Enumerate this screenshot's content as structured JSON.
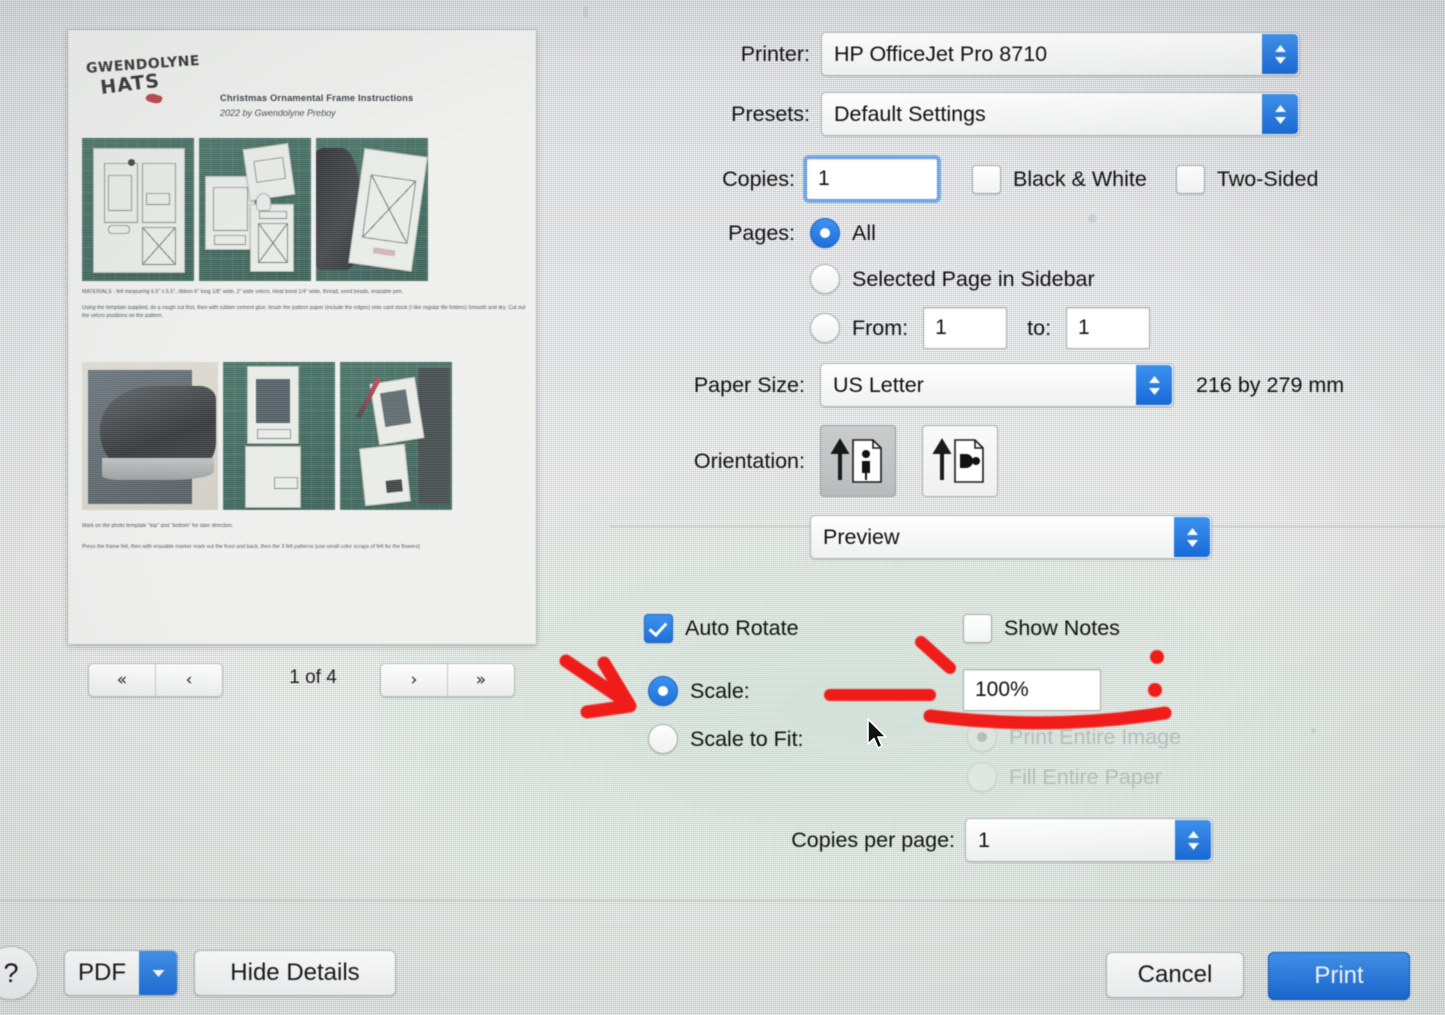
{
  "dialog": {
    "printer": {
      "label": "Printer:",
      "value": "HP OfficeJet Pro 8710"
    },
    "presets": {
      "label": "Presets:",
      "value": "Default Settings"
    },
    "copies": {
      "label": "Copies:",
      "value": "1"
    },
    "black_white": {
      "label": "Black & White",
      "checked": false
    },
    "two_sided": {
      "label": "Two-Sided",
      "checked": false
    },
    "pages": {
      "label": "Pages:",
      "all": "All",
      "selected_page": "Selected Page in Sidebar",
      "from_label": "From:",
      "from_value": "1",
      "to_label": "to:",
      "to_value": "1",
      "selection": "All"
    },
    "paper_size": {
      "label": "Paper Size:",
      "value": "US Letter",
      "dimensions": "216 by 279 mm"
    },
    "orientation": {
      "label": "Orientation:",
      "portrait_icon": "portrait-page-icon",
      "landscape_icon": "landscape-page-icon",
      "selected": "portrait"
    },
    "pane": {
      "value": "Preview"
    },
    "auto_rotate": {
      "label": "Auto Rotate",
      "checked": true
    },
    "show_notes": {
      "label": "Show Notes",
      "checked": false
    },
    "scale": {
      "label": "Scale:",
      "selected": true,
      "value": "100%"
    },
    "scale_to_fit": {
      "label": "Scale to Fit:",
      "selected": false
    },
    "print_entire_image": {
      "label": "Print Entire Image",
      "selected": true,
      "disabled": true
    },
    "fill_entire_paper": {
      "label": "Fill Entire Paper",
      "selected": false,
      "disabled": true
    },
    "copies_per_page": {
      "label": "Copies per page:",
      "value": "1"
    }
  },
  "preview": {
    "nav": {
      "first_label": "«",
      "prev_label": "‹",
      "next_label": "›",
      "last_label": "»",
      "page_indicator": "1 of 4"
    },
    "document": {
      "logo_line1": "GWENDOLYNE",
      "logo_line2": "HATS",
      "title": "Christmas Ornamental Frame Instructions",
      "subtitle": "2022 by Gwendolyne Preboy",
      "paragraph1": "MATERIALS -  felt measuring 6.5\" x 5.5\", ribbon 6\" long 1/8\" wide, 2\" wide velcro, Heat bond 1/4\" wide, thread, seed beads, erasable pen.",
      "paragraph2": "Using the template supplied, do a rough cut first, then with rubber cement glue, brush the pattern paper (include the edges) onto card stock (I like regular file folders) Smooth and dry. Cut out the velcro positions on the pattern.",
      "paragraph3": "Mark on the photo template \"top\" and \"bottom\" for later direction.",
      "paragraph4": "Press the frame felt, then with erasable marker mark out the front and back, then the 3 felt patterns (use small color scraps of felt for the flowers)"
    }
  },
  "bottom_bar": {
    "help_label": "?",
    "pdf_label": "PDF",
    "hide_details_label": "Hide Details",
    "cancel_label": "Cancel",
    "print_label": "Print"
  },
  "annotations": {
    "arrow": "red-arrow-pointing-to-scale-radio",
    "underline": "red-underline-under-scale-field",
    "dash": "red-dash-left-of-scale-field",
    "tick": "red-tick-above-scale-field",
    "dots": "red-dots-right-of-scale-field",
    "color": "#f01c19"
  },
  "colors": {
    "accent_blue": "#1f70da",
    "annotation_red": "#f01c19",
    "window_bg": "#e4e6e5"
  }
}
